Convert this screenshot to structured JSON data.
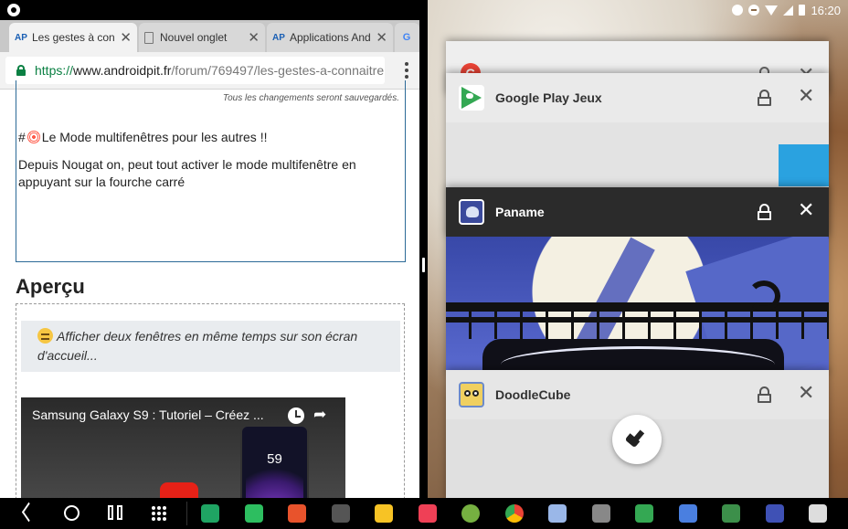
{
  "browser": {
    "tabs": [
      {
        "label": "Les gestes à con",
        "icon": "androidpit-icon",
        "icon_text": "AP",
        "active": true
      },
      {
        "label": "Nouvel onglet",
        "icon": "page-icon",
        "active": false
      },
      {
        "label": "Applications And",
        "icon": "androidpit-icon",
        "icon_text": "AP",
        "active": false
      },
      {
        "label": "",
        "icon": "google-icon",
        "icon_text": "G",
        "active": false
      }
    ],
    "url": {
      "scheme": "https://",
      "host": "www.androidpit.fr",
      "path": "/forum/769497/les-gestes-a-connaitre"
    }
  },
  "editor": {
    "saved_note": "Tous les changements seront sauvegardés.",
    "heading_prefix": "#",
    "heading_text": "Le Mode multifenêtres pour les autres !!",
    "body": "Depuis Nougat on, peut tout activer le mode multifenêtre en appuyant sur la fourche carré"
  },
  "preview": {
    "title": "Aperçu",
    "quote": "Afficher deux fenêtres en même temps sur son écran d'accueil...",
    "video_title": "Samsung Galaxy S9 : Tutoriel – Créez ...",
    "phone_time": "59"
  },
  "status": {
    "time": "16:20"
  },
  "recents": {
    "cards": [
      {
        "name": "Google",
        "icon": "google-icon"
      },
      {
        "name": "Google Play Jeux",
        "icon": "google-play-games-icon"
      },
      {
        "name": "Paname",
        "icon": "paname-icon"
      },
      {
        "name": "DoodleCube",
        "icon": "doodlecube-icon"
      }
    ],
    "clear_all_icon": "broom-icon"
  },
  "taskbar": {
    "apps": [
      {
        "icon": "google-drive-icon",
        "color": "#1fa463"
      },
      {
        "icon": "evernote-icon",
        "color": "#2dbe60"
      },
      {
        "icon": "microsoft-office-icon",
        "color": "#e8532c"
      },
      {
        "icon": "screen-mirror-icon",
        "color": "#555555"
      },
      {
        "icon": "norton-icon",
        "color": "#f7c325"
      },
      {
        "icon": "pocket-icon",
        "color": "#ef4056"
      },
      {
        "icon": "settings-icon",
        "color": "#76b041"
      },
      {
        "icon": "chrome-icon",
        "color": "#4285f4"
      },
      {
        "icon": "messages-icon",
        "color": "#9ab7e8"
      },
      {
        "icon": "keyboard-icon",
        "color": "#888888"
      },
      {
        "icon": "google-maps-icon",
        "color": "#34a853"
      },
      {
        "icon": "voice-recorder-icon",
        "color": "#4a7fe0"
      },
      {
        "icon": "home-icon",
        "color": "#3c8f4a"
      },
      {
        "icon": "more-apps-icon",
        "color": "#3f51b5"
      },
      {
        "icon": "camera-icon",
        "color": "#dddddd"
      }
    ]
  }
}
